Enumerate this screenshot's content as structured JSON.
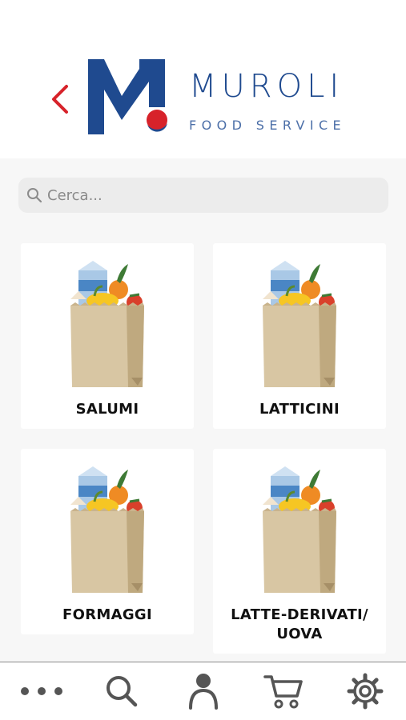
{
  "header": {
    "brand_name": "MUROLI",
    "brand_tagline": "FOOD SERVICE",
    "back_icon": "chevron-left-icon",
    "accent_color": "#d7222a",
    "brand_color": "#1f4a8f"
  },
  "search": {
    "placeholder": "Cerca...",
    "value": "",
    "icon": "search-icon"
  },
  "categories": [
    {
      "label": "SALUMI",
      "icon": "grocery-bag-icon"
    },
    {
      "label": "LATTICINI",
      "icon": "grocery-bag-icon"
    },
    {
      "label": "FORMAGGI",
      "icon": "grocery-bag-icon"
    },
    {
      "label": "LATTE-DERIVATI/ UOVA",
      "label_line1": "LATTE-DERIVATI/",
      "label_line2": "UOVA",
      "icon": "grocery-bag-icon"
    }
  ],
  "bottom_nav": [
    {
      "name": "more",
      "icon": "more-dots-icon"
    },
    {
      "name": "search",
      "icon": "search-icon"
    },
    {
      "name": "account",
      "icon": "user-icon"
    },
    {
      "name": "cart",
      "icon": "cart-icon"
    },
    {
      "name": "settings",
      "icon": "gear-icon"
    }
  ]
}
